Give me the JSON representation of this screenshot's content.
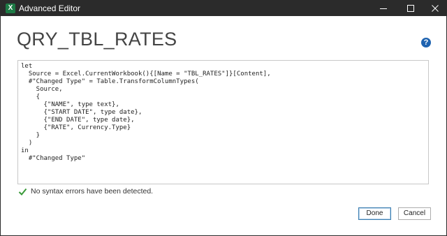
{
  "window": {
    "title": "Advanced Editor",
    "app_icon": "excel-icon",
    "app_icon_letter": "X",
    "controls": {
      "minimize_icon": "minimize-icon",
      "maximize_icon": "maximize-icon",
      "close_icon": "close-icon"
    }
  },
  "query": {
    "name": "QRY_TBL_RATES"
  },
  "help": {
    "icon": "help-icon",
    "glyph": "?"
  },
  "editor": {
    "lines": [
      "let",
      "  Source = Excel.CurrentWorkbook(){[Name = \"TBL_RATES\"]}[Content],",
      "  #\"Changed Type\" = Table.TransformColumnTypes(",
      "    Source,",
      "    {",
      "      {\"NAME\", type text},",
      "      {\"START DATE\", type date},",
      "      {\"END DATE\", type date},",
      "      {\"RATE\", Currency.Type}",
      "    }",
      "  )",
      "in",
      "  #\"Changed Type\""
    ]
  },
  "status": {
    "icon": "checkmark-icon",
    "message": "No syntax errors have been detected."
  },
  "buttons": {
    "done": "Done",
    "cancel": "Cancel"
  },
  "colors": {
    "titlebar": "#2b2b2b",
    "excel_green": "#1d7a45",
    "help_blue": "#1f63b0",
    "check_green": "#3a9a3a",
    "default_button_border": "#3c7fb1"
  }
}
